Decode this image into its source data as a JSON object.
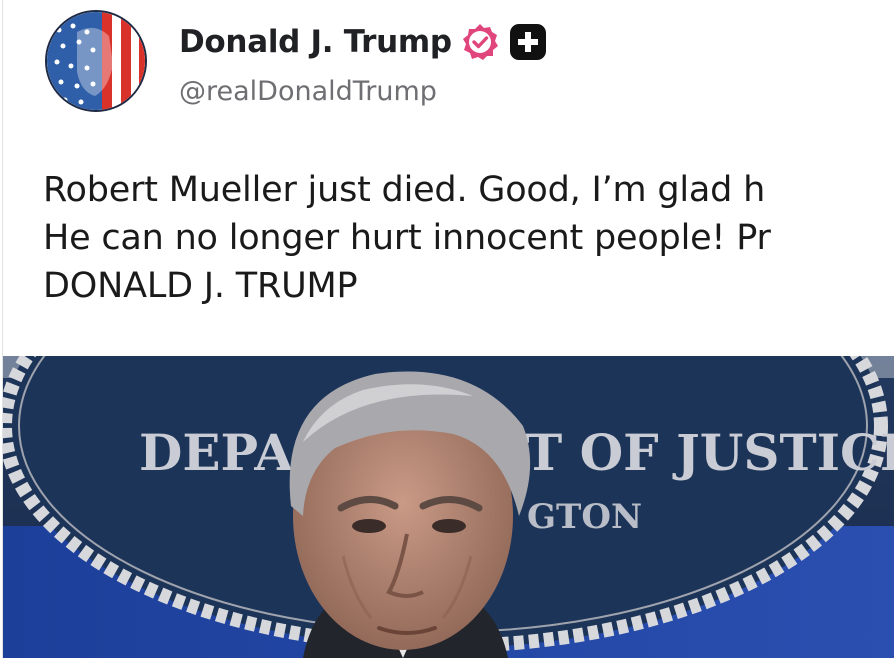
{
  "author": {
    "display_name": "Donald J. Trump",
    "handle": "@realDonaldTrump",
    "verified_color": "#e0457b",
    "plus_badge_color": "#111111"
  },
  "post": {
    "lines": [
      "Robert Mueller just died. Good, I’m glad h",
      "He can no longer hurt innocent people! Pr",
      "DONALD J. TRUMP"
    ]
  },
  "media": {
    "seal_text_left": "DEPA",
    "seal_text_right": "T OF JUSTICE",
    "seal_subtext": "GTON"
  }
}
